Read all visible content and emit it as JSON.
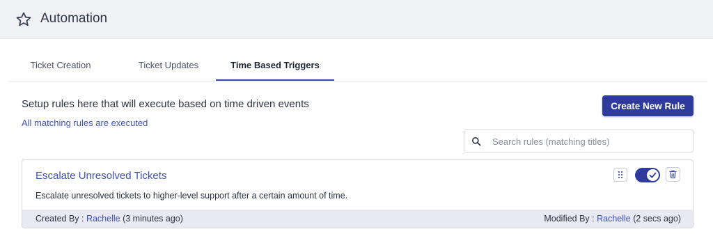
{
  "header": {
    "title": "Automation",
    "icon": "star-icon"
  },
  "tabs": [
    {
      "label": "Ticket Creation",
      "active": false
    },
    {
      "label": "Ticket Updates",
      "active": false
    },
    {
      "label": "Time Based Triggers",
      "active": true
    }
  ],
  "main": {
    "description": "Setup rules here that will execute based on time driven events",
    "subtext": "All matching rules are executed",
    "create_button": "Create New Rule",
    "search": {
      "placeholder": "Search rules (matching titles)",
      "value": ""
    }
  },
  "rules": [
    {
      "title": "Escalate Unresolved Tickets",
      "description": "Escalate unresolved tickets to higher-level support after a certain amount of time.",
      "created_label": "Created By : ",
      "created_by": "Rachelle",
      "created_when": " (3 minutes ago)",
      "modified_label": "Modified By : ",
      "modified_by": "Rachelle",
      "modified_when": " (2 secs ago)",
      "enabled": true
    }
  ],
  "colors": {
    "accent": "#2e3a9c",
    "link": "#3f52b5",
    "footer_bg": "#e8e9f3"
  }
}
